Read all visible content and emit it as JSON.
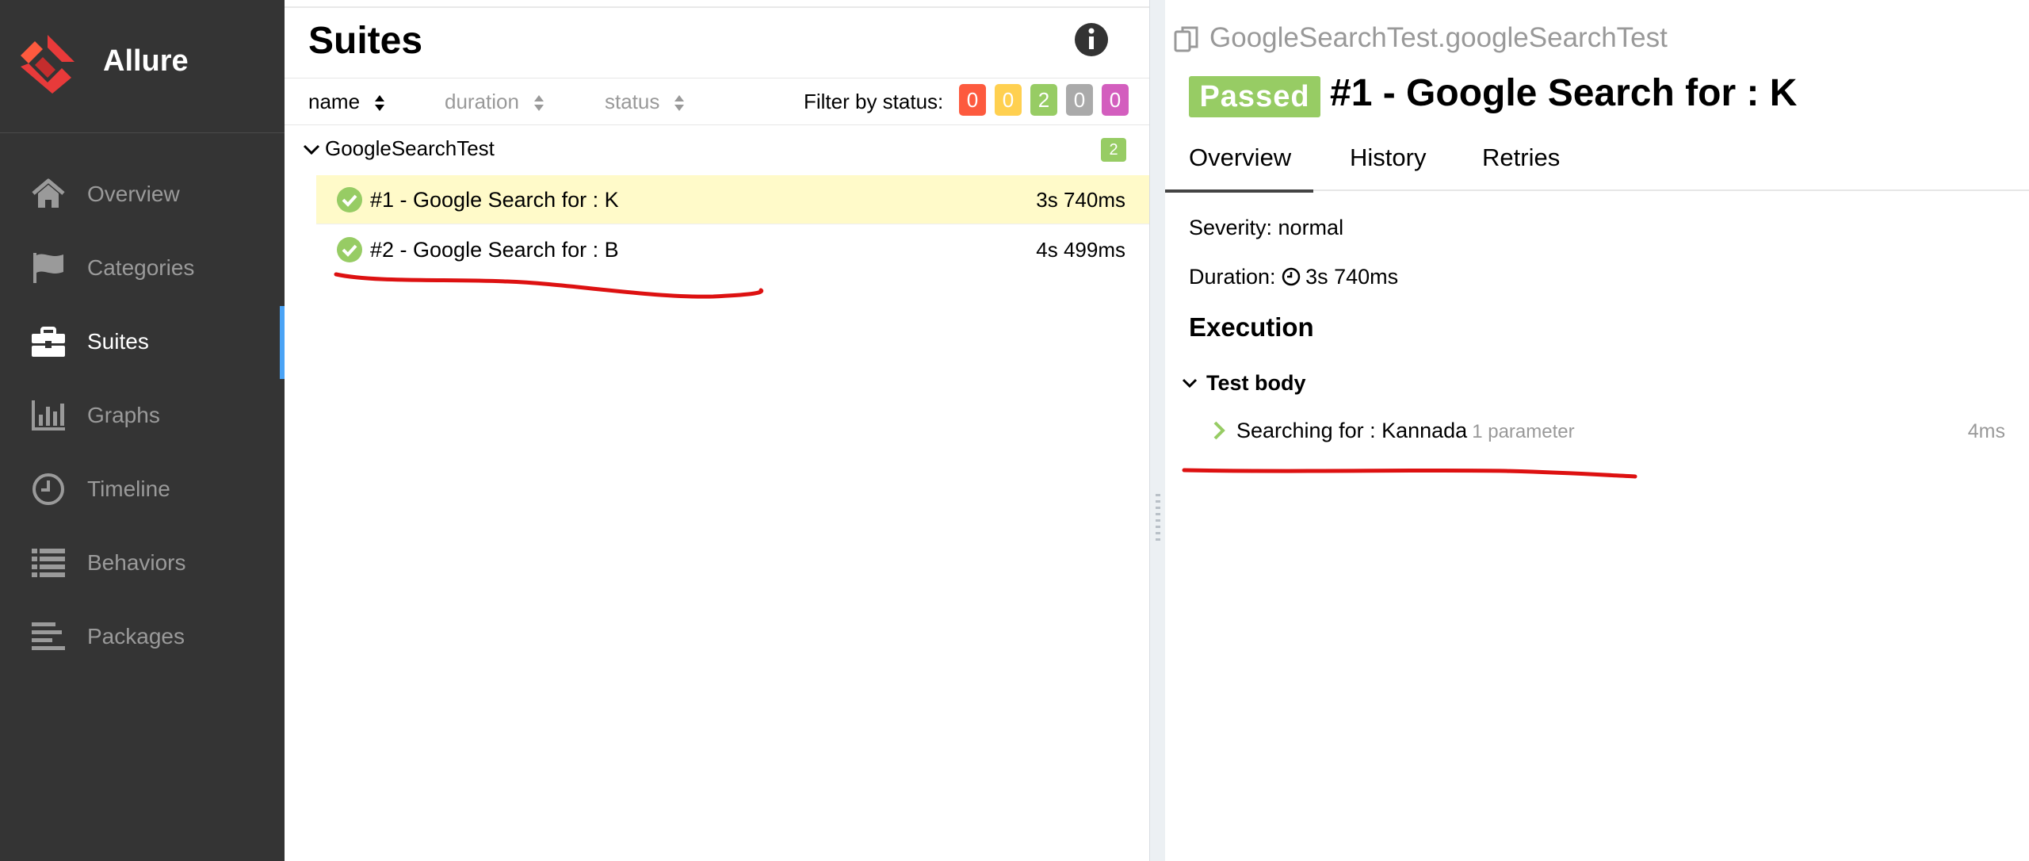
{
  "sidebar": {
    "brand": "Allure",
    "items": [
      {
        "label": "Overview",
        "icon": "home-icon"
      },
      {
        "label": "Categories",
        "icon": "flag-icon"
      },
      {
        "label": "Suites",
        "icon": "briefcase-icon",
        "active": true
      },
      {
        "label": "Graphs",
        "icon": "bar-chart-icon"
      },
      {
        "label": "Timeline",
        "icon": "clock-icon"
      },
      {
        "label": "Behaviors",
        "icon": "list-icon"
      },
      {
        "label": "Packages",
        "icon": "align-left-icon"
      }
    ]
  },
  "suites": {
    "title": "Suites",
    "sort": {
      "name": "name",
      "duration": "duration",
      "status": "status"
    },
    "filter_label": "Filter by status:",
    "status_badges": [
      {
        "count": "0",
        "color": "#fd5a3e"
      },
      {
        "count": "0",
        "color": "#ffd050"
      },
      {
        "count": "2",
        "color": "#97cc64"
      },
      {
        "count": "0",
        "color": "#aaaaaa"
      },
      {
        "count": "0",
        "color": "#d35ebe"
      }
    ],
    "group": {
      "name": "GoogleSearchTest",
      "count": "2"
    },
    "tests": [
      {
        "name": "#1 - Google Search for : K",
        "duration": "3s 740ms",
        "selected": true
      },
      {
        "name": "#2 - Google Search for : B",
        "duration": "4s 499ms"
      }
    ]
  },
  "detail": {
    "breadcrumb": "GoogleSearchTest.googleSearchTest",
    "status": "Passed",
    "title": "#1 - Google Search for : K",
    "tabs": [
      "Overview",
      "History",
      "Retries"
    ],
    "severity": "Severity: normal",
    "duration_label": "Duration:",
    "duration": "3s 740ms",
    "execution": "Execution",
    "test_body": "Test body",
    "step": {
      "label": "Searching for : Kannada",
      "params": "1 parameter",
      "duration": "4ms"
    }
  },
  "colors": {
    "passed": "#97cc64",
    "sidebar": "#343434",
    "accent": "#4aa3f5",
    "annotation": "#dd1111"
  }
}
